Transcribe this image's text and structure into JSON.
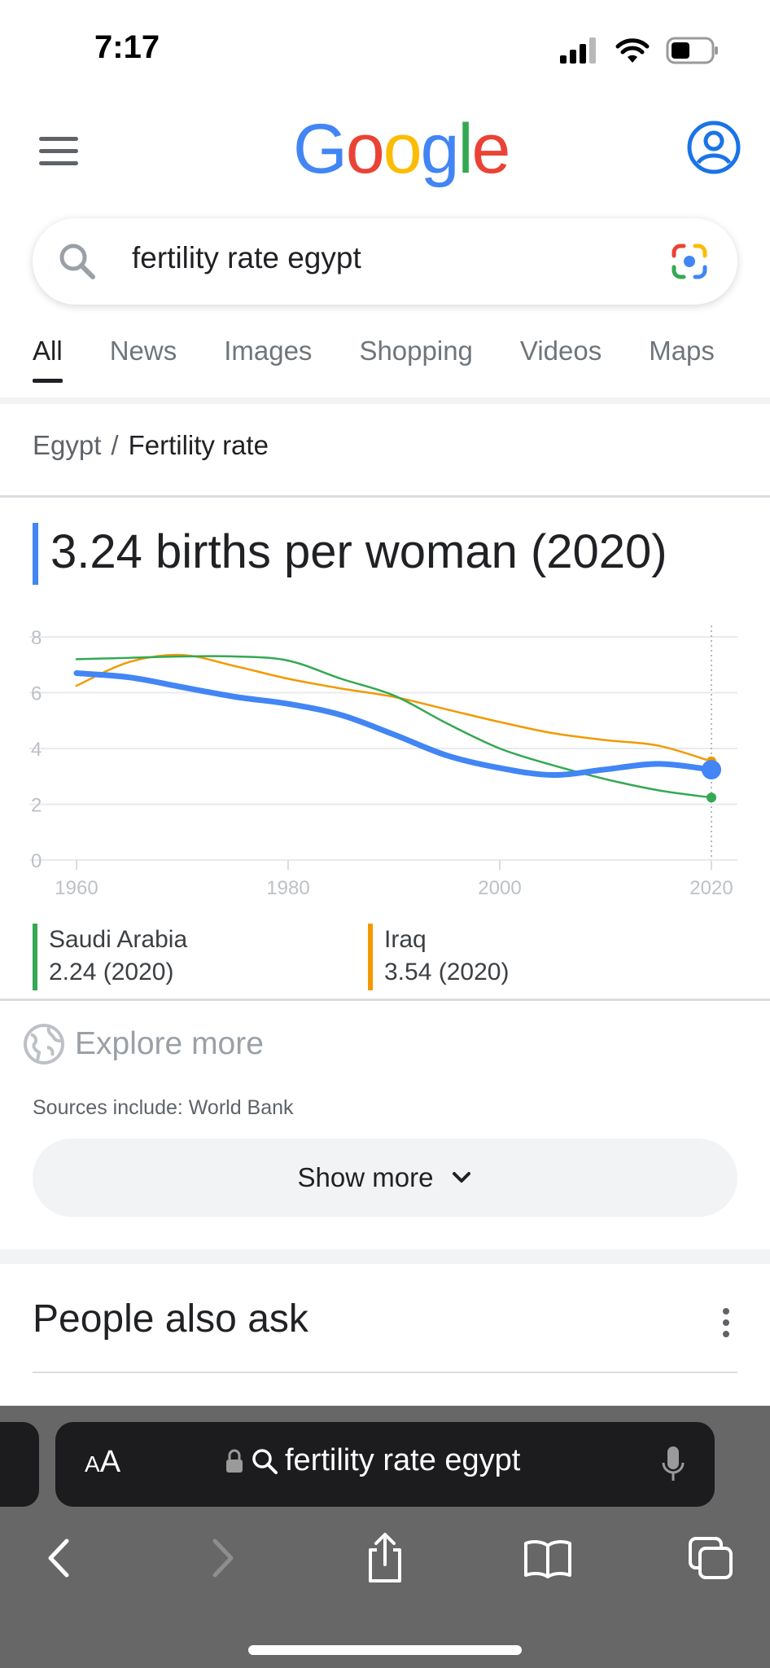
{
  "status": {
    "time": "7:17"
  },
  "header": {
    "logo_letters": [
      {
        "ch": "G",
        "color": "#4285F4"
      },
      {
        "ch": "o",
        "color": "#EA4335"
      },
      {
        "ch": "o",
        "color": "#FBBC05"
      },
      {
        "ch": "g",
        "color": "#4285F4"
      },
      {
        "ch": "l",
        "color": "#34A853"
      },
      {
        "ch": "e",
        "color": "#EA4335"
      }
    ]
  },
  "search": {
    "query": "fertility rate egypt"
  },
  "tabs": [
    "All",
    "News",
    "Images",
    "Shopping",
    "Videos",
    "Maps"
  ],
  "active_tab": "All",
  "breadcrumb": {
    "country": "Egypt",
    "separator": "/",
    "topic": "Fertility rate"
  },
  "headline": "3.24 births per woman (2020)",
  "chart_data": {
    "type": "line",
    "title": "",
    "xlabel": "",
    "ylabel": "",
    "xlim": [
      1960,
      2020
    ],
    "ylim": [
      0,
      8
    ],
    "x_ticks": [
      1960,
      1980,
      2000,
      2020
    ],
    "y_ticks": [
      0,
      2,
      4,
      6,
      8
    ],
    "grid": true,
    "series": [
      {
        "name": "Egypt",
        "color": "#4285F4",
        "x": [
          1960,
          1965,
          1970,
          1975,
          1980,
          1985,
          1990,
          1995,
          2000,
          2005,
          2010,
          2015,
          2020
        ],
        "values": [
          6.7,
          6.55,
          6.2,
          5.85,
          5.6,
          5.2,
          4.5,
          3.75,
          3.3,
          3.05,
          3.25,
          3.45,
          3.24
        ]
      },
      {
        "name": "Saudi Arabia",
        "color": "#34A853",
        "x": [
          1960,
          1965,
          1970,
          1975,
          1980,
          1985,
          1990,
          1995,
          2000,
          2005,
          2010,
          2015,
          2020
        ],
        "values": [
          7.2,
          7.25,
          7.3,
          7.3,
          7.15,
          6.5,
          5.9,
          4.9,
          4.0,
          3.4,
          2.9,
          2.5,
          2.24
        ]
      },
      {
        "name": "Iraq",
        "color": "#F29900",
        "x": [
          1960,
          1965,
          1970,
          1975,
          1980,
          1985,
          1990,
          1995,
          2000,
          2005,
          2010,
          2015,
          2020
        ],
        "values": [
          6.25,
          7.1,
          7.35,
          6.95,
          6.5,
          6.15,
          5.85,
          5.4,
          4.95,
          4.55,
          4.3,
          4.1,
          3.54
        ]
      }
    ],
    "legend": [
      {
        "name": "Saudi Arabia",
        "value": "2.24 (2020)",
        "color": "#34A853"
      },
      {
        "name": "Iraq",
        "value": "3.54 (2020)",
        "color": "#F29900"
      }
    ]
  },
  "explore": {
    "label": "Explore more"
  },
  "sources": "Sources include: World Bank",
  "show_more": "Show more",
  "people_also_ask": "People also ask",
  "safari": {
    "aa_large": "A",
    "aa_small": "A",
    "address": "fertility rate egypt"
  }
}
